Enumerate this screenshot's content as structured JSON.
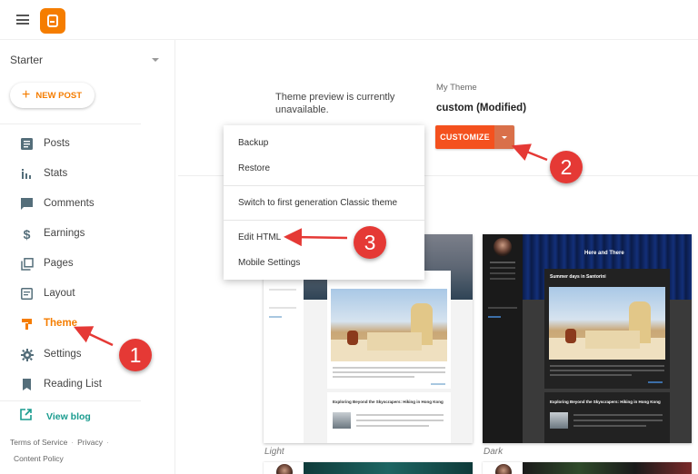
{
  "header": {
    "menu_icon": "hamburger-icon",
    "logo_icon": "blogger-logo"
  },
  "sidebar": {
    "blog_name": "Starter",
    "new_post_label": "NEW POST",
    "items": [
      {
        "label": "Posts",
        "icon": "posts-icon"
      },
      {
        "label": "Stats",
        "icon": "stats-icon"
      },
      {
        "label": "Comments",
        "icon": "comments-icon"
      },
      {
        "label": "Earnings",
        "icon": "dollar-icon"
      },
      {
        "label": "Pages",
        "icon": "pages-icon"
      },
      {
        "label": "Layout",
        "icon": "layout-icon"
      },
      {
        "label": "Theme",
        "icon": "theme-icon",
        "active": true
      },
      {
        "label": "Settings",
        "icon": "gear-icon"
      },
      {
        "label": "Reading List",
        "icon": "bookmark-icon"
      }
    ],
    "view_blog_label": "View blog",
    "footer_links": [
      "Terms of Service",
      "Privacy",
      "Content Policy"
    ]
  },
  "main": {
    "preview_message": "Theme preview is currently unavailable.",
    "my_theme_label": "My Theme",
    "theme_name": "custom (Modified)",
    "customize_label": "CUSTOMIZE",
    "dropdown_menu": {
      "items": [
        "Backup",
        "Restore",
        "Switch to first generation Classic theme",
        "Edit HTML",
        "Mobile Settings"
      ]
    },
    "themes": [
      {
        "caption": "Light",
        "post_title": "Exploring Beyond the Skyscrapers: Hiking in Hong Kong"
      },
      {
        "caption": "Dark",
        "blog_title": "Here and There",
        "post_title_1": "Summer days in Santorini",
        "post_title": "Exploring Beyond the Skyscrapers: Hiking in Hong Kong"
      }
    ]
  },
  "annotations": {
    "step_1": "1",
    "step_2": "2",
    "step_3": "3",
    "color": "#e53935"
  },
  "colors": {
    "brand_orange": "#f57d00",
    "customize_button": "#f4511e",
    "view_blog_teal": "#1a9c8f"
  }
}
